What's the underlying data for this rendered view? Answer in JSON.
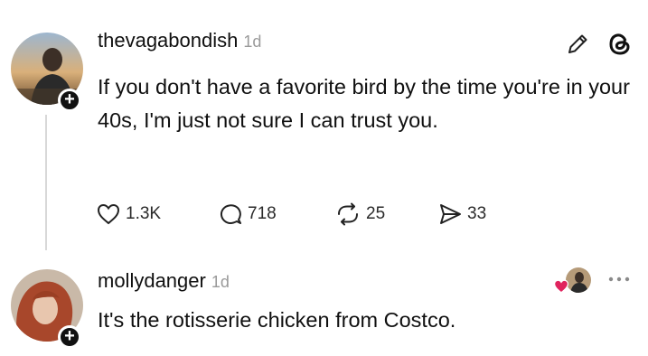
{
  "post": {
    "username": "thevagabondish",
    "time": "1d",
    "text": "If you don't have a favorite bird by the time you're in your 40s, I'm just not sure I can trust you.",
    "likes": "1.3K",
    "replies": "718",
    "reposts": "25",
    "shares": "33"
  },
  "reply": {
    "username": "mollydanger",
    "time": "1d",
    "text": "It's the rotisserie chicken from Costco."
  },
  "icons": {
    "post_edit": "pencil-icon",
    "app_logo": "threads-logo-icon",
    "like": "heart-icon",
    "reply": "speech-bubble-icon",
    "repost": "repost-arrows-icon",
    "share": "send-icon",
    "more": "ellipsis-icon"
  },
  "colors": {
    "heart_badge": "#e0245e",
    "muted": "#9a9a9a"
  }
}
